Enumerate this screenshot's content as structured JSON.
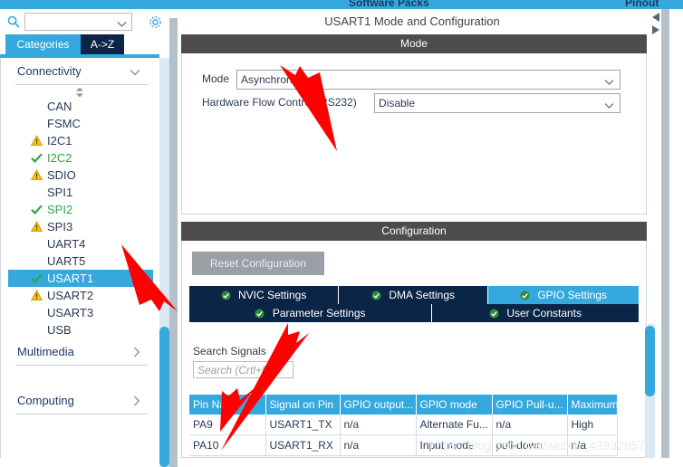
{
  "topbar": {
    "left_title": "Software Packs",
    "right_title": "Pinout"
  },
  "sidebar": {
    "search": {
      "value": "",
      "placeholder": ""
    },
    "gear_tooltip": "Settings",
    "tabs": [
      {
        "label": "Categories",
        "active": true
      },
      {
        "label": "A->Z",
        "active": false
      }
    ],
    "groups": [
      {
        "label": "Connectivity",
        "expanded": true,
        "items": [
          {
            "label": "CAN",
            "status": "none",
            "selected": false
          },
          {
            "label": "FSMC",
            "status": "none",
            "selected": false
          },
          {
            "label": "I2C1",
            "status": "warning",
            "selected": false
          },
          {
            "label": "I2C2",
            "status": "ok",
            "selected": false
          },
          {
            "label": "SDIO",
            "status": "warning",
            "selected": false
          },
          {
            "label": "SPI1",
            "status": "none",
            "selected": false
          },
          {
            "label": "SPI2",
            "status": "ok",
            "selected": false
          },
          {
            "label": "SPI3",
            "status": "warning",
            "selected": false
          },
          {
            "label": "UART4",
            "status": "none",
            "selected": false
          },
          {
            "label": "UART5",
            "status": "none",
            "selected": false
          },
          {
            "label": "USART1",
            "status": "ok",
            "selected": true
          },
          {
            "label": "USART2",
            "status": "warning",
            "selected": false
          },
          {
            "label": "USART3",
            "status": "none",
            "selected": false
          },
          {
            "label": "USB",
            "status": "none",
            "selected": false
          }
        ]
      },
      {
        "label": "Multimedia",
        "expanded": false,
        "items": []
      },
      {
        "label": "Computing",
        "expanded": false,
        "items": []
      }
    ]
  },
  "main": {
    "title": "USART1 Mode and Configuration",
    "mode_section": {
      "header": "Mode",
      "fields": [
        {
          "label": "Mode",
          "value": "Asynchronous"
        },
        {
          "label": "Hardware Flow Control (RS232)",
          "value": "Disable"
        }
      ]
    },
    "config_section": {
      "header": "Configuration",
      "reset_button": "Reset Configuration",
      "tabs": [
        {
          "label": "NVIC Settings",
          "active": false
        },
        {
          "label": "DMA Settings",
          "active": false
        },
        {
          "label": "GPIO Settings",
          "active": true
        },
        {
          "label": "Parameter Settings",
          "active": false
        },
        {
          "label": "User Constants",
          "active": false
        }
      ],
      "search_signals_label": "Search Signals",
      "search_signals_placeholder": "Search (Crtl+F)",
      "search_signals_value": "",
      "table": {
        "columns": [
          "Pin Name",
          "Signal on Pin",
          "GPIO output...",
          "GPIO mode",
          "GPIO Pull-u...",
          "Maximum"
        ],
        "rows": [
          [
            "PA9",
            "USART1_TX",
            "n/a",
            "Alternate Fu...",
            "n/a",
            "High"
          ],
          [
            "PA10",
            "USART1_RX",
            "n/a",
            "Input mode",
            "pull-down",
            "n/a"
          ]
        ]
      }
    }
  },
  "watermark": "https://blog.csdn.net/weixin_43932857",
  "colors": {
    "accent": "#35a8dd",
    "tab_dark": "#0b2546",
    "section_header": "#4d4d4d",
    "warning": "#f5c518",
    "ok": "#2aa84a",
    "annotation_arrow": "#ff0000"
  }
}
